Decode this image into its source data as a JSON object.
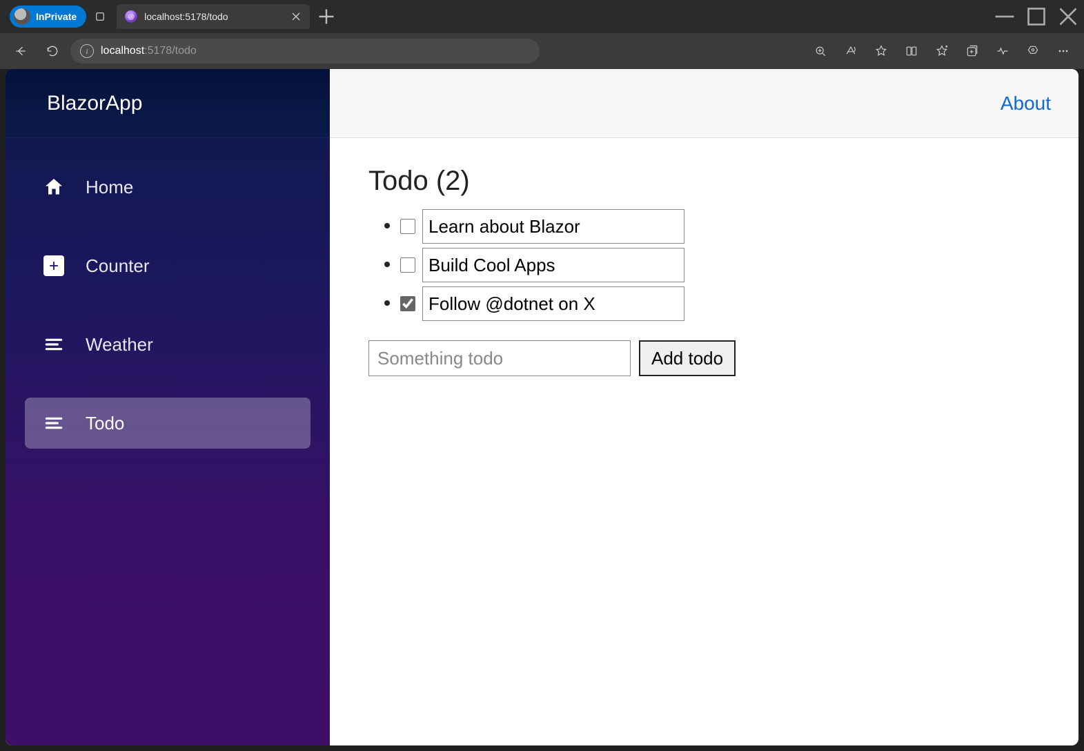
{
  "browser": {
    "inprivate_label": "InPrivate",
    "tab_title": "localhost:5178/todo",
    "url_host": "localhost",
    "url_path": ":5178/todo",
    "address_info_glyph": "i"
  },
  "sidebar": {
    "brand": "BlazorApp",
    "items": [
      {
        "label": "Home"
      },
      {
        "label": "Counter"
      },
      {
        "label": "Weather"
      },
      {
        "label": "Todo"
      }
    ]
  },
  "header": {
    "about": "About"
  },
  "todo": {
    "heading": "Todo (2)",
    "items": [
      {
        "title": "Learn about Blazor",
        "done": false
      },
      {
        "title": "Build Cool Apps",
        "done": false
      },
      {
        "title": "Follow @dotnet on X",
        "done": true
      }
    ],
    "placeholder": "Something todo",
    "add_label": "Add todo"
  }
}
